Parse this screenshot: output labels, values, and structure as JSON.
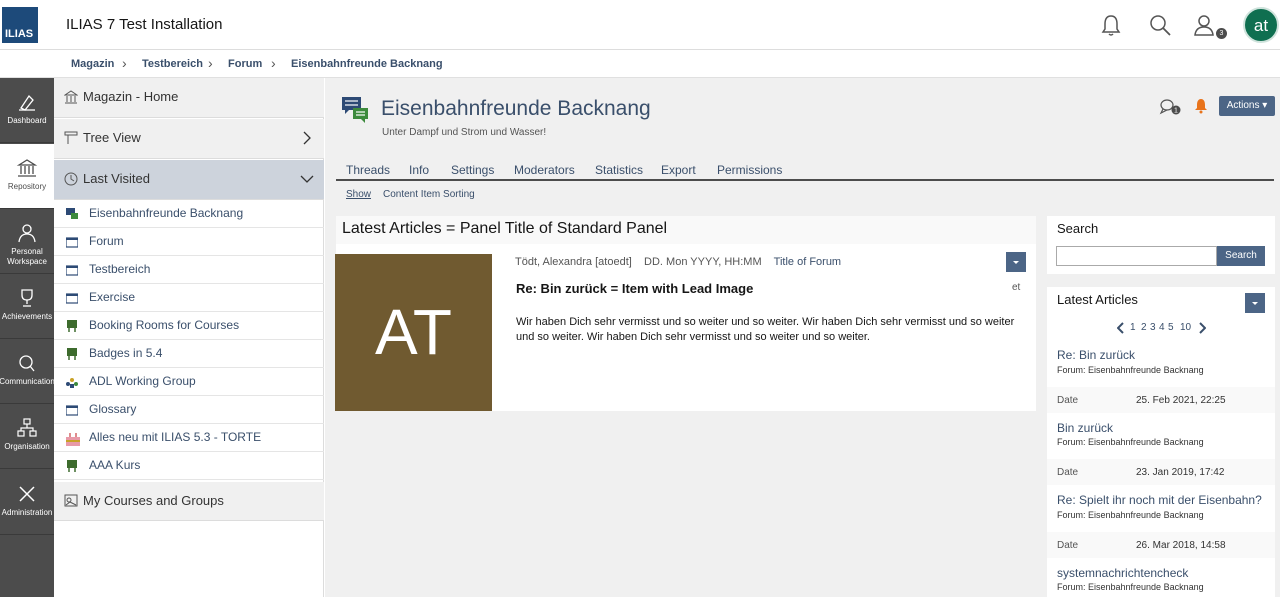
{
  "header": {
    "logo_text": "ILIAS",
    "app_title": "ILIAS 7 Test Installation",
    "notification_badge": "3",
    "avatar_initials": "at"
  },
  "breadcrumb": [
    "Magazin",
    "Testbereich",
    "Forum",
    "Eisenbahnfreunde Backnang"
  ],
  "mainbar": [
    {
      "label": "Dashboard",
      "icon": "dashboard-icon"
    },
    {
      "label": "Repository",
      "icon": "repository-icon"
    },
    {
      "label": "Personal Workspace",
      "icon": "personal-workspace-icon"
    },
    {
      "label": "Achievements",
      "icon": "trophy-icon"
    },
    {
      "label": "Communication",
      "icon": "communication-icon"
    },
    {
      "label": "Organisation",
      "icon": "organisation-icon"
    },
    {
      "label": "Administration",
      "icon": "administration-icon"
    }
  ],
  "slate": {
    "home": "Magazin - Home",
    "tree_view": "Tree View",
    "last_visited": "Last Visited",
    "my_courses": "My Courses and Groups",
    "last_visited_items": [
      {
        "label": "Eisenbahnfreunde Backnang",
        "icon": "forum-icon"
      },
      {
        "label": "Forum",
        "icon": "category-icon"
      },
      {
        "label": "Testbereich",
        "icon": "category-icon"
      },
      {
        "label": "Exercise",
        "icon": "category-icon"
      },
      {
        "label": "Booking Rooms for Courses",
        "icon": "booking-icon"
      },
      {
        "label": "Badges in 5.4",
        "icon": "booking-icon"
      },
      {
        "label": "ADL Working Group",
        "icon": "group-icon"
      },
      {
        "label": "Glossary",
        "icon": "category-icon"
      },
      {
        "label": "Alles neu mit ILIAS 5.3 - TORTE",
        "icon": "cake-icon"
      },
      {
        "label": "AAA Kurs",
        "icon": "booking-icon"
      }
    ]
  },
  "page": {
    "title": "Eisenbahnfreunde Backnang",
    "subtitle": "Unter Dampf und Strom und Wasser!",
    "comments_badge": "1",
    "actions_label": "Actions"
  },
  "tabs": [
    "Threads",
    "Info",
    "Settings",
    "Moderators",
    "Statistics",
    "Export",
    "Permissions"
  ],
  "subtabs": [
    "Show",
    "Content Item Sorting"
  ],
  "panel": {
    "title": "Latest Articles = Panel Title  of Standard Panel",
    "lead_image_text": "AT",
    "meta_author": "Tödt, Alexandra [atoedt]",
    "meta_date": "DD. Mon YYYY, HH:MM",
    "meta_forum_link": "Title of Forum",
    "item_title": "Re: Bin zurück  = Item with Lead Image",
    "item_text": "Wir haben Dich sehr vermisst und so weiter und so weiter. Wir haben Dich sehr vermisst und so weiter und so weiter.  Wir haben Dich sehr vermisst und so weiter und so weiter.",
    "item_side": "et"
  },
  "search": {
    "title": "Search",
    "button": "Search",
    "value": ""
  },
  "latest_articles": {
    "title": "Latest Articles",
    "pages": [
      "1",
      "2",
      "3",
      "4",
      "5",
      "10"
    ],
    "date_label": "Date",
    "items": [
      {
        "title": "Re: Bin zurück",
        "forum": "Forum: Eisenbahnfreunde Backnang",
        "date": "25. Feb 2021, 22:25"
      },
      {
        "title": "Bin zurück",
        "forum": "Forum: Eisenbahnfreunde Backnang",
        "date": "23. Jan 2019, 17:42"
      },
      {
        "title": "Re: Spielt ihr noch mit der Eisenbahn?",
        "forum": "Forum: Eisenbahnfreunde Backnang",
        "date": "26. Mar 2018, 14:58"
      },
      {
        "title": "systemnachrichtencheck",
        "forum": "Forum: Eisenbahnfreunde Backnang",
        "date": ""
      }
    ]
  },
  "colors": {
    "accent": "#4c6586",
    "link": "#3a4f6b",
    "mainbar": "#4c4c4c",
    "avatar": "#0f6f50",
    "lead_image": "#705a30",
    "notification": "#e8731b"
  }
}
